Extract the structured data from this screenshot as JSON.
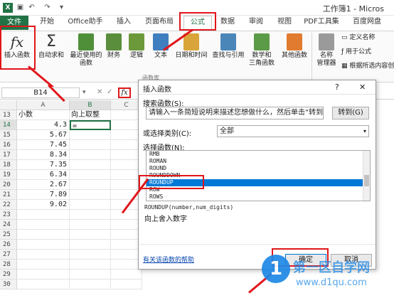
{
  "window": {
    "title": "工作簿1 - Micros"
  },
  "quick_access": {
    "save_icon": "save-icon",
    "undo_icon": "undo-icon",
    "redo_icon": "redo-icon"
  },
  "tabs": [
    {
      "label": "文件"
    },
    {
      "label": "开始"
    },
    {
      "label": "Office助手"
    },
    {
      "label": "插入"
    },
    {
      "label": "页面布局"
    },
    {
      "label": "公式"
    },
    {
      "label": "数据"
    },
    {
      "label": "审阅"
    },
    {
      "label": "视图"
    },
    {
      "label": "PDF工具集"
    },
    {
      "label": "百度网盘"
    }
  ],
  "ribbon": {
    "insert_function": "插入函数",
    "autosum": "自动求和",
    "recent_1": "最近使用的",
    "recent_2": "函数",
    "financial": "财务",
    "logical": "逻辑",
    "text": "文本",
    "datetime": "日期和时间",
    "lookup": "查找与引用",
    "math_1": "数学和",
    "math_2": "三角函数",
    "more": "其他函数",
    "name_mgr_1": "名称",
    "name_mgr_2": "管理器",
    "define_name": "定义名称",
    "use_in_formula": "用于公式",
    "create_from_sel": "根据所选内容创",
    "group_label": "函数库"
  },
  "formula_bar": {
    "name_box": "B14",
    "fx": "fx"
  },
  "sheet": {
    "columns": [
      "A",
      "B",
      "C"
    ],
    "rows": [
      {
        "n": "13",
        "a": "小数",
        "b": "向上取整"
      },
      {
        "n": "14",
        "a": "4.3",
        "b": "="
      },
      {
        "n": "15",
        "a": "5.67",
        "b": ""
      },
      {
        "n": "16",
        "a": "7.45",
        "b": ""
      },
      {
        "n": "17",
        "a": "8.34",
        "b": ""
      },
      {
        "n": "18",
        "a": "7.35",
        "b": ""
      },
      {
        "n": "19",
        "a": "6.34",
        "b": ""
      },
      {
        "n": "20",
        "a": "2.67",
        "b": ""
      },
      {
        "n": "21",
        "a": "7.89",
        "b": ""
      },
      {
        "n": "22",
        "a": "9.02",
        "b": ""
      },
      {
        "n": "23",
        "a": "",
        "b": ""
      },
      {
        "n": "24",
        "a": "",
        "b": ""
      },
      {
        "n": "25",
        "a": "",
        "b": ""
      },
      {
        "n": "26",
        "a": "",
        "b": ""
      },
      {
        "n": "27",
        "a": "",
        "b": ""
      },
      {
        "n": "28",
        "a": "",
        "b": ""
      },
      {
        "n": "29",
        "a": "",
        "b": ""
      },
      {
        "n": "30",
        "a": "",
        "b": ""
      }
    ]
  },
  "dialog": {
    "title": "插入函数",
    "help": "?",
    "close": "✕",
    "search_label": "搜索函数(S):",
    "search_value": "请输入一条简短说明来描述您想做什么，然后单击“转到”",
    "go_button": "转到(G)",
    "category_label": "或选择类别(C):",
    "category_value": "全部",
    "select_label": "选择函数(N):",
    "functions": [
      "RMB",
      "ROMAN",
      "ROUND",
      "ROUNDDOWN",
      "ROUNDUP",
      "ROW",
      "ROWS"
    ],
    "selected_function": "ROUNDUP",
    "signature": "ROUNDUP(number,num_digits)",
    "description": "向上舍入数字",
    "help_link": "有关该函数的帮助",
    "ok": "确定",
    "cancel": "取消"
  },
  "watermark": {
    "site": "第一区自学网",
    "url": "www.d1qu.com",
    "logo_text": "1"
  },
  "colors": {
    "excel_green": "#217346",
    "highlight_red": "#e0161b",
    "selection_blue": "#0078d7"
  }
}
